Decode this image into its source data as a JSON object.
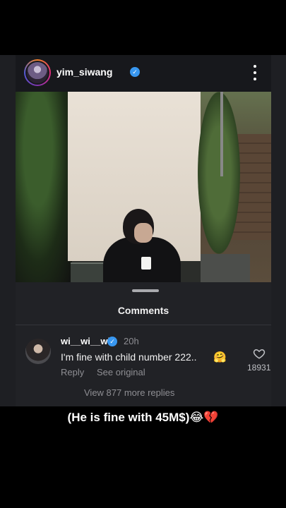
{
  "post": {
    "username": "yim_siwang",
    "verified_mark": "✓",
    "avatar_icon": "profile-avatar",
    "more_icon": "three-dots-vertical-icon"
  },
  "comments_sheet": {
    "title": "Comments",
    "comment": {
      "username": "wi__wi__wi",
      "verified_mark": "✓",
      "time": "20h",
      "text": "I'm fine with child number 222..",
      "emoji": "🤗",
      "reply_label": "Reply",
      "see_original_label": "See original",
      "like_count": "18931",
      "like_icon": "heart-outline-icon"
    },
    "view_more_label": "View 877 more replies"
  },
  "caption": "(He is fine with 45M$)😂💔"
}
